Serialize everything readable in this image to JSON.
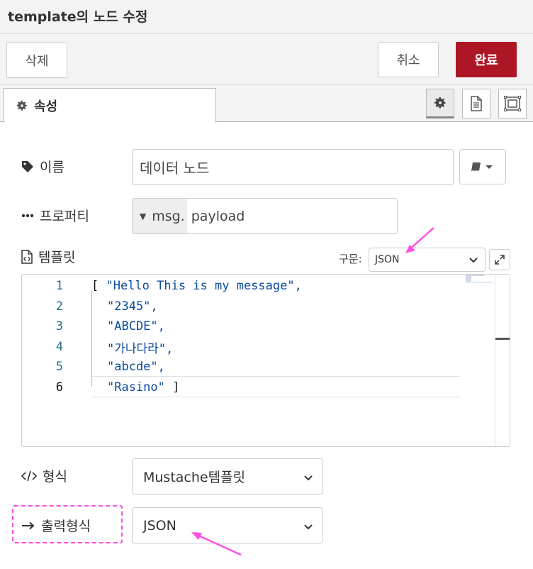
{
  "window": {
    "title": "template의 노드 수정"
  },
  "toolbar": {
    "delete_label": "삭제",
    "cancel_label": "취소",
    "done_label": "완료"
  },
  "tabs": {
    "properties_label": "속성"
  },
  "form": {
    "name_label": "이름",
    "name_value": "데이터 노드",
    "property_label": "프로퍼티",
    "property_prefix": "msg.",
    "property_value": "payload",
    "template_label": "템플릿",
    "syntax_label": "구문:",
    "syntax_value": "JSON",
    "format_label": "형식",
    "format_value": "Mustache템플릿",
    "output_label": "출력형식",
    "output_value": "JSON"
  },
  "editor": {
    "lines": [
      {
        "number": "1",
        "text": "\"Hello This is my message\",",
        "open": "[ ",
        "close": ""
      },
      {
        "number": "2",
        "text": "\"2345\",",
        "open": "",
        "close": ""
      },
      {
        "number": "3",
        "text": "\"ABCDE\",",
        "open": "",
        "close": ""
      },
      {
        "number": "4",
        "text": "\"가나다라\",",
        "open": "",
        "close": ""
      },
      {
        "number": "5",
        "text": "\"abcde\",",
        "open": "",
        "close": ""
      },
      {
        "number": "6",
        "text": "\"Rasino\"",
        "open": "",
        "close": " ]"
      }
    ]
  },
  "colors": {
    "accent_done": "#ad1625",
    "annotation": "#ff4fe0",
    "code_string": "#0b4a9e",
    "line_number": "#236e8e"
  },
  "icons": [
    "gear-icon",
    "description-icon",
    "layout-icon",
    "tag-icon",
    "ellipsis-icon",
    "file-code-icon",
    "book-icon",
    "caret-down-icon",
    "expand-icon",
    "code-icon",
    "arrow-right-icon",
    "chevron-down-icon"
  ]
}
